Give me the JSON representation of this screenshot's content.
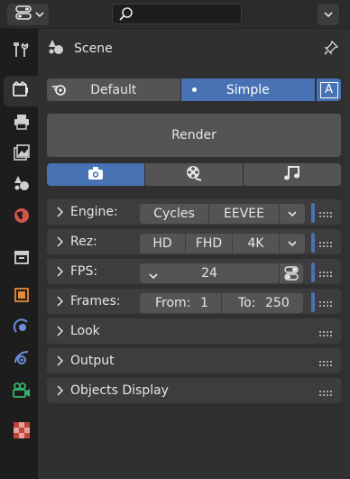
{
  "topbar": {
    "editor_type_icon": "properties-editor-icon",
    "search_placeholder": "",
    "options_icon": "chevron-down-icon"
  },
  "sidebar": {
    "tabs": [
      {
        "name": "tool-icon",
        "color": "#cfcfcf"
      },
      {
        "name": "render-icon",
        "color": "#cfcfcf",
        "active": true
      },
      {
        "name": "output-icon",
        "color": "#cfcfcf"
      },
      {
        "name": "view-layer-icon",
        "color": "#cfcfcf"
      },
      {
        "name": "scene-icon",
        "color": "#cfcfcf"
      },
      {
        "name": "world-icon",
        "color": "#d0554a"
      },
      {
        "name": "collection-icon",
        "color": "#cfcfcf"
      },
      {
        "name": "object-icon",
        "color": "#e88a33"
      },
      {
        "name": "modifier-icon",
        "color": "#6c8ee0"
      },
      {
        "name": "physics-icon",
        "color": "#6c8ee0"
      },
      {
        "name": "camera-data-icon",
        "color": "#36b46c"
      },
      {
        "name": "texture-icon",
        "color": "#d0554a"
      }
    ]
  },
  "header": {
    "title": "Scene",
    "icon": "scene-icon",
    "pin_icon": "pin-icon"
  },
  "mode": {
    "default_label": "Default",
    "simple_label": "Simple",
    "a_label": "A"
  },
  "render": {
    "label": "Render"
  },
  "segment_tabs": [
    {
      "name": "camera-icon"
    },
    {
      "name": "film-reel-icon"
    },
    {
      "name": "music-note-icon"
    }
  ],
  "panels": {
    "engine": {
      "label": "Engine:",
      "options": [
        "Cycles",
        "EEVEE"
      ]
    },
    "rez": {
      "label": "Rez:",
      "options": [
        "HD",
        "FHD",
        "4K"
      ]
    },
    "fps": {
      "label": "FPS:",
      "value": "24"
    },
    "frames": {
      "label": "Frames:",
      "from_label": "From:",
      "from_value": "1",
      "to_label": "To:",
      "to_value": "250"
    },
    "look": {
      "label": "Look"
    },
    "output": {
      "label": "Output"
    },
    "objects_display": {
      "label": "Objects Display"
    }
  },
  "colors": {
    "accent": "#4772b3",
    "panel": "#3d3d3d",
    "button": "#545454",
    "background": "#303030"
  }
}
